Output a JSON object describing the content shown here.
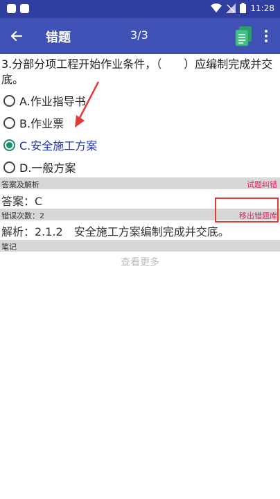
{
  "status_bar": {
    "time": "11:28"
  },
  "app_bar": {
    "title": "错题",
    "pager": "3/3"
  },
  "question": {
    "text": "3.分部分项工程开始作业条件，（　　）应编制完成并交底。",
    "options": [
      {
        "label": "A.作业指导书",
        "selected": false
      },
      {
        "label": "B.作业票",
        "selected": false
      },
      {
        "label": "C.安全施工方案",
        "selected": true
      },
      {
        "label": "D.一般方案",
        "selected": false
      }
    ]
  },
  "answer_section": {
    "header": "答案及解析",
    "report_link": "试题纠错",
    "answer": "答案：C",
    "wrong_count": "错误次数：2",
    "remove_link": "移出错题库",
    "analysis": "解析：2.1.2　安全施工方案编制完成并交底。"
  },
  "notes_section": {
    "header": "笔记",
    "see_more": "查看更多"
  },
  "colors": {
    "status_bar": "#303f9f",
    "app_bar": "#3f51b5",
    "selected_radio": "#1b8f6e",
    "selected_text": "#1f33b5",
    "link_red": "#e0245e",
    "annotation_red": "#e53935"
  },
  "icons": [
    "back-arrow-icon",
    "document-icon",
    "more-vertical-icon",
    "wifi-icon",
    "signal-icon",
    "battery-icon"
  ]
}
